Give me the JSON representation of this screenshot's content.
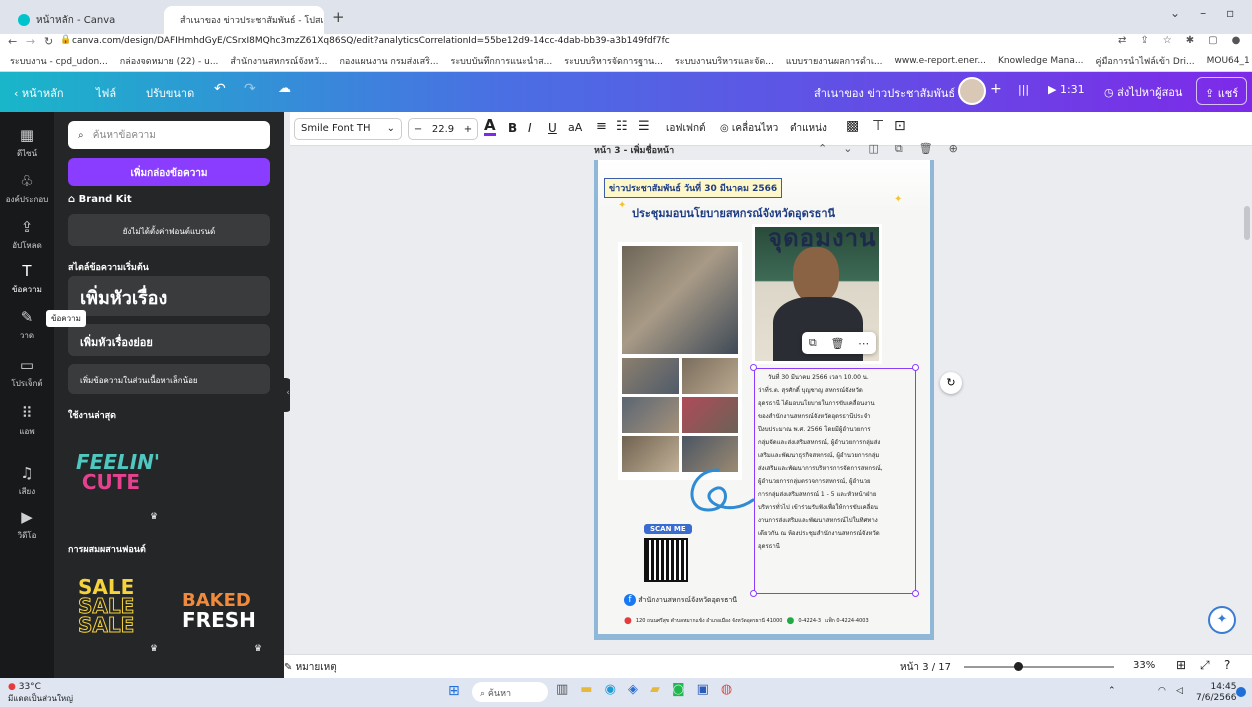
{
  "browser": {
    "tabs": [
      {
        "title": "หน้าหลัก - Canva",
        "active": false
      },
      {
        "title": "สำเนาของ ข่าวประชาสัมพันธ์ - โปสเ...",
        "active": true
      }
    ],
    "new_tab": "+",
    "url": "canva.com/design/DAFIHmhdGyE/CSrxI8MQhc3mzZ61Xq86SQ/edit?analyticsCorrelationId=55be12d9-14cc-4dab-bb39-a3b149fdf7fc",
    "bookmarks": [
      "ระบบงาน - cpd_udon...",
      "กล่องจดหมาย (22) - u...",
      "สำนักงานสหกรณ์จังหวั...",
      "กองแผนงาน กรมส่งเสริ...",
      "ระบบบันทึกการแนะนำส...",
      "ระบบบริหารจัดการฐาน...",
      "ระบบงานบริหารและจัด...",
      "แบบรายงานผลการดำเ...",
      "www.e-report.ener...",
      "Knowledge Mana...",
      "คู่มือการนำไฟล์เข้า Dri...",
      "MOU64_1 - Google..."
    ]
  },
  "header": {
    "back": "หน้าหลัก",
    "file": "ไฟล์",
    "resize": "ปรับขนาด",
    "doc_title": "สำเนาของ ข่าวประชาสัมพันธ์",
    "analytics": "|||",
    "play": "1:31",
    "submit": "ส่งไปหาผู้สอน",
    "share": "แชร์"
  },
  "rail": [
    {
      "icon": "▦",
      "label": "ดีไซน์"
    },
    {
      "icon": "♧",
      "label": "องค์ประกอบ"
    },
    {
      "icon": "⇪",
      "label": "อัปโหลด"
    },
    {
      "icon": "T",
      "label": "ข้อความ"
    },
    {
      "icon": "✎",
      "label": "วาด"
    },
    {
      "icon": "▭",
      "label": "โปรเจ็กต์"
    },
    {
      "icon": "⠿",
      "label": "แอพ"
    },
    {
      "icon": "♫",
      "label": "เสียง"
    },
    {
      "icon": "▶",
      "label": "วิดีโอ"
    }
  ],
  "rail_tooltip": "ข้อความ",
  "panel": {
    "search_placeholder": "ค้นหาข้อความ",
    "add_textbox": "เพิ่มกล่องข้อความ",
    "brand_kit": "Brand Kit",
    "brand_fonts": "ยังไม่ได้ตั้งค่าฟอนต์แบรนด์",
    "default_styles": "สไตล์ข้อความเริ่มต้น",
    "add_heading": "เพิ่มหัวเรื่อง",
    "add_subheading": "เพิ่มหัวเรื่องย่อย",
    "add_body": "เพิ่มข้อความในส่วนเนื้อหาเล็กน้อย",
    "recently_used": "ใช้งานล่าสุด",
    "recent_sample_line1": "FEELIN'",
    "recent_sample_line2": "CUTE",
    "font_combos": "การผสมผสานฟอนต์",
    "combo1": "SALE",
    "combo2_line1": "BAKED",
    "combo2_line2": "FRESH"
  },
  "toolbar": {
    "font": "Smile Font TH",
    "minus": "−",
    "size": "22.9",
    "plus": "+",
    "bold": "B",
    "italic": "I",
    "underline": "U",
    "case": "aA",
    "effects": "เอฟเฟกต์",
    "animate": "เคลื่อนไหว",
    "position": "ตำแหน่ง"
  },
  "page_label": "หน้า 3 - เพิ่มชื่อหน้า",
  "poster": {
    "date_banner": "ข่าวประชาสัมพันธ์ วันที่ 30 มีนาคม 2566",
    "title": "ประชุมมอบนโยบายสหกรณ์จังหวัดอุดรธานี",
    "person_sign": "จุดอมงาน",
    "body_lines": [
      "วันที่ 30 มีนาคม 2566 เวลา 10.00 น.",
      "ว่าที่ร.ต. สุรศักดิ์ บุญชาญ สหกรณ์จังหวัด",
      "อุดรธานี ได้มอบนโยบายในการขับเคลื่อนงาน",
      "ของสำนักงานสหกรณ์จังหวัดอุดรธานีประจำ",
      "ปีงบประมาณ พ.ศ. 2566 โดยมีผู้อำนวยการ",
      "กลุ่มจัดและส่งเสริมสหกรณ์, ผู้อำนวยการกลุ่มส่ง",
      "เสริมและพัฒนาธุรกิจสหกรณ์, ผู้อำนวยการกลุ่ม",
      "ส่งเสริมและพัฒนาการบริหารการจัดการสหกรณ์,",
      "ผู้อำนวยการกลุ่มตรวจการสหกรณ์, ผู้อำนวย",
      "การกลุ่มส่งเสริมสหกรณ์ 1 - 5 และหัวหน้าฝ่าย",
      "บริหารทั่วไป เข้าร่วมรับฟังเพื่อให้การขับเคลื่อน",
      "งานการส่งเสริมและพัฒนาสหกรณ์ไปในทิศทาง",
      "เดียวกัน ณ ห้องประชุมสำนักงานสหกรณ์จังหวัด",
      "อุดรธานี"
    ],
    "scan_me": "SCAN ME",
    "facebook": "สำนักงานสหกรณ์จังหวัดอุดรธานี",
    "address": "120 ถนนศรีสุข ตำบลหมากแข้ง อำเภอเมือง จังหวัดอุดรธานี 41000",
    "phone": "0-4224-3",
    "fax": "แฟ็ก 0-4224-4003"
  },
  "bottom": {
    "notes": "หมายเหตุ",
    "page_indicator": "หน้า 3 / 17",
    "zoom": "33%",
    "zoom_level": 0.33
  },
  "taskbar": {
    "weather_temp": "33°C",
    "weather_text": "มีแดดเป็นส่วนใหญ่",
    "search": "ค้นหา",
    "time": "14:45",
    "date": "7/6/2566"
  }
}
